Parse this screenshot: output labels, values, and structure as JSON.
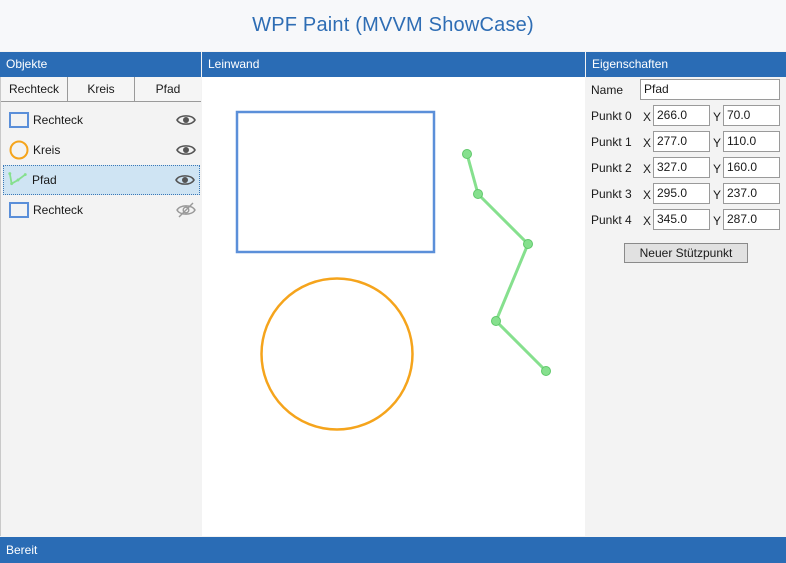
{
  "window": {
    "title": "WPF Paint (MVVM ShowCase)"
  },
  "objects_panel": {
    "header": "Objekte",
    "tabs": [
      {
        "label": "Rechteck"
      },
      {
        "label": "Kreis"
      },
      {
        "label": "Pfad"
      }
    ],
    "items": [
      {
        "label": "Rechteck",
        "icon": "rectangle-icon",
        "visible": true,
        "selected": false
      },
      {
        "label": "Kreis",
        "icon": "circle-icon",
        "visible": true,
        "selected": false
      },
      {
        "label": "Pfad",
        "icon": "path-icon",
        "visible": true,
        "selected": true
      },
      {
        "label": "Rechteck",
        "icon": "rectangle-icon",
        "visible": false,
        "selected": false
      }
    ]
  },
  "canvas_panel": {
    "header": "Leinwand",
    "colors": {
      "rectangle": "#5b8fd9",
      "circle": "#f5a41c",
      "path": "#86e08e"
    }
  },
  "properties_panel": {
    "header": "Eigenschaften",
    "name_label": "Name",
    "name_value": "Pfad",
    "x_label": "X",
    "y_label": "Y",
    "points": [
      {
        "label": "Punkt 0",
        "x": "266.0",
        "y": "70.0"
      },
      {
        "label": "Punkt 1",
        "x": "277.0",
        "y": "110.0"
      },
      {
        "label": "Punkt 2",
        "x": "327.0",
        "y": "160.0"
      },
      {
        "label": "Punkt 3",
        "x": "295.0",
        "y": "237.0"
      },
      {
        "label": "Punkt 4",
        "x": "345.0",
        "y": "287.0"
      }
    ],
    "add_point_label": "Neuer Stützpunkt"
  },
  "status": {
    "text": "Bereit"
  },
  "colors": {
    "accent": "#2a6cb5",
    "title_text": "#2e6db4",
    "selection": "#cfe4f3"
  }
}
